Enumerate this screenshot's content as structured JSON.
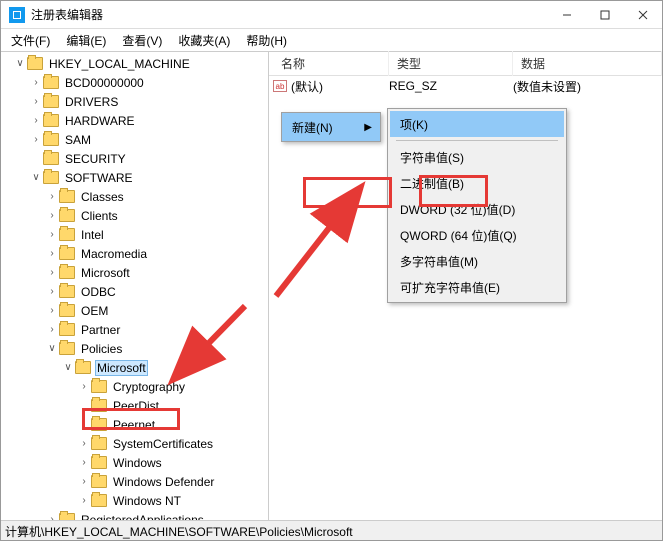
{
  "window": {
    "title": "注册表编辑器"
  },
  "menu": {
    "file": "文件(F)",
    "edit": "编辑(E)",
    "view": "查看(V)",
    "favorites": "收藏夹(A)",
    "help": "帮助(H)"
  },
  "tree": {
    "root": "HKEY_LOCAL_MACHINE",
    "bcd": "BCD00000000",
    "drivers": "DRIVERS",
    "hardware": "HARDWARE",
    "sam": "SAM",
    "security": "SECURITY",
    "software": "SOFTWARE",
    "classes": "Classes",
    "clients": "Clients",
    "intel": "Intel",
    "macromedia": "Macromedia",
    "microsoft1": "Microsoft",
    "odbc": "ODBC",
    "oem": "OEM",
    "partner": "Partner",
    "policies": "Policies",
    "microsoft2": "Microsoft",
    "crypto": "Cryptography",
    "peerdist": "PeerDist",
    "peernet": "Peernet",
    "syscerts": "SystemCertificates",
    "windows": "Windows",
    "windef": "Windows Defender",
    "winnt": "Windows NT",
    "regapps": "RegisteredApplications"
  },
  "list": {
    "hdr_name": "名称",
    "hdr_type": "类型",
    "hdr_data": "数据",
    "row_name": "(默认)",
    "row_type": "REG_SZ",
    "row_data": "(数值未设置)"
  },
  "ctx": {
    "new": "新建(N)",
    "key": "项(K)",
    "string": "字符串值(S)",
    "binary": "二进制值(B)",
    "dword": "DWORD (32 位)值(D)",
    "qword": "QWORD (64 位)值(Q)",
    "multi": "多字符串值(M)",
    "expand": "可扩充字符串值(E)"
  },
  "status": {
    "path": "计算机\\HKEY_LOCAL_MACHINE\\SOFTWARE\\Policies\\Microsoft"
  }
}
